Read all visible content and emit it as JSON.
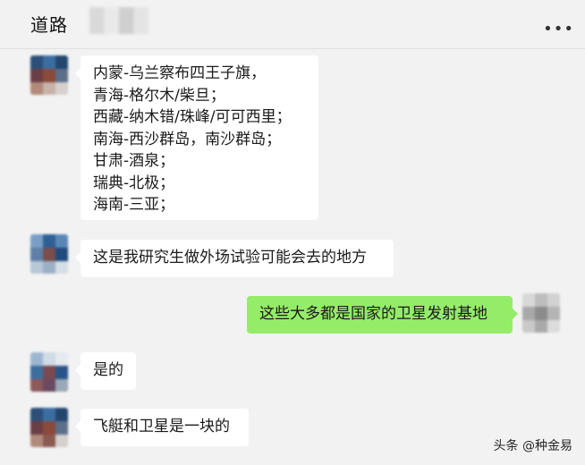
{
  "header": {
    "title": "道路",
    "more_icon": "more-dots-icon"
  },
  "messages": [
    {
      "sender": "other",
      "lines": [
        "内蒙-乌兰察布四王子旗，",
        "青海-格尔木/柴旦；",
        "西藏-纳木错/珠峰/可可西里；",
        "南海-西沙群岛，南沙群岛；",
        "甘肃-酒泉；",
        "瑞典-北极；",
        "海南-三亚；"
      ]
    },
    {
      "sender": "other",
      "text": "这是我研究生做外场试验可能会去的地方"
    },
    {
      "sender": "me",
      "text": "这些大多都是国家的卫星发射基地"
    },
    {
      "sender": "other",
      "text": "是的"
    },
    {
      "sender": "other",
      "text": "飞艇和卫星是一块的"
    }
  ],
  "watermark": "头条 @种金易",
  "colors": {
    "background": "#f2f2f2",
    "bubble_other": "#ffffff",
    "bubble_me": "#95ec69"
  }
}
